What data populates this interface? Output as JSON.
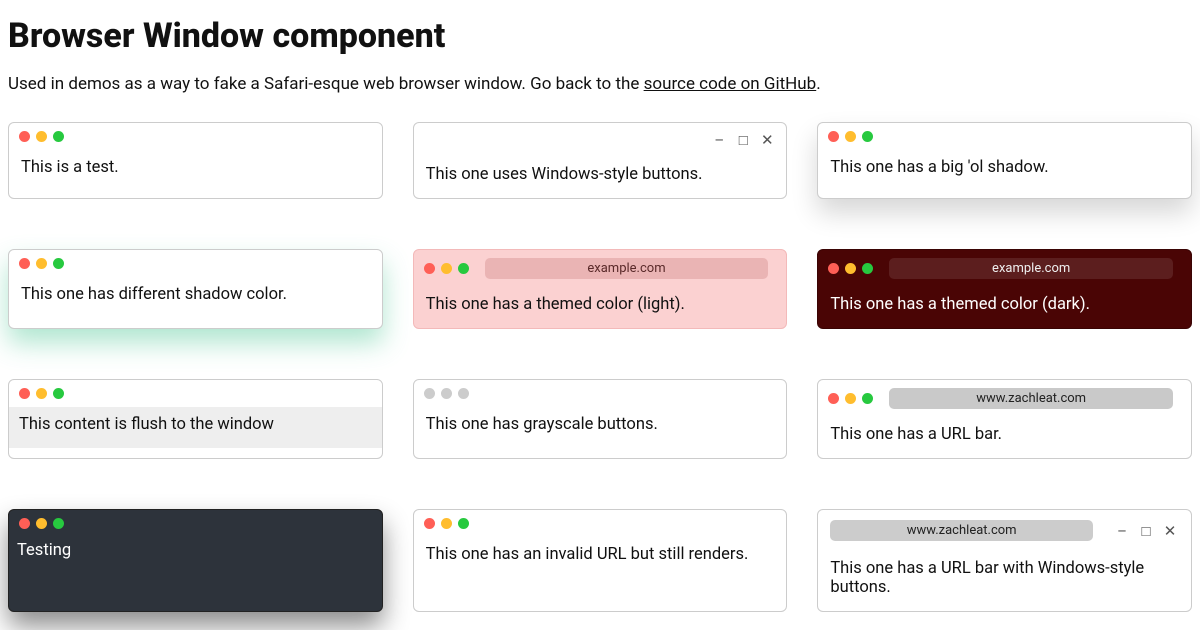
{
  "title": "Browser Window component",
  "intro_before": "Used in demos as a way to fake a Safari-esque web browser window. Go back to the ",
  "intro_link": "source code on GitHub",
  "intro_after": ".",
  "demos": [
    {
      "content": "This is a test."
    },
    {
      "content": "This one uses Windows-style buttons."
    },
    {
      "content": "This one has a big 'ol shadow."
    },
    {
      "content": "This one has different shadow color."
    },
    {
      "url": "example.com",
      "content": "This one has a themed color (light)."
    },
    {
      "url": "example.com",
      "content": "This one has a themed color (dark)."
    },
    {
      "content": "This content is flush to the window"
    },
    {
      "content": "This one has grayscale buttons."
    },
    {
      "url": "www.zachleat.com",
      "content": "This one has a URL bar."
    },
    {
      "content": "Testing"
    },
    {
      "content": "This one has an invalid URL but still renders."
    },
    {
      "url": "www.zachleat.com",
      "content": "This one has a URL bar with Windows-style buttons."
    }
  ]
}
